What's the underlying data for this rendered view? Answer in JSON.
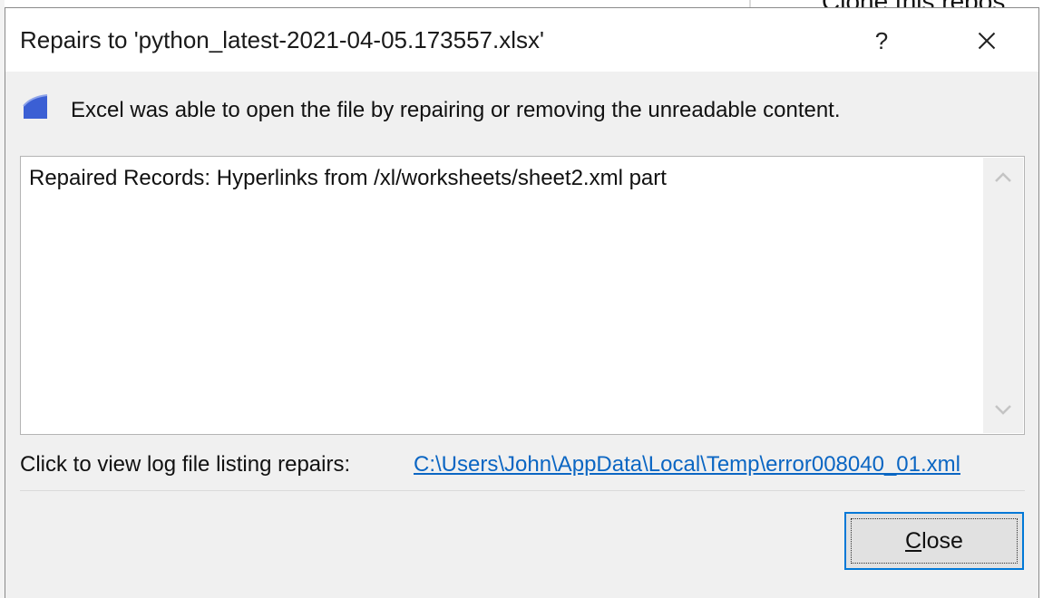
{
  "dialog": {
    "title": "Repairs to 'python_latest-2021-04-05.173557.xlsx'",
    "help_label": "?",
    "message": "Excel was able to open the file by repairing or removing the unreadable content.",
    "details": "Repaired Records: Hyperlinks from /xl/worksheets/sheet2.xml part",
    "log_label": "Click to view log file listing repairs:",
    "log_link": "C:\\Users\\John\\AppData\\Local\\Temp\\error008040_01.xml",
    "close_button": {
      "accesskey": "C",
      "rest": "lose"
    }
  },
  "background": {
    "text": "Clone this repos"
  },
  "colors": {
    "accent": "#0078d7",
    "link": "#0b66c3",
    "dialog_bg": "#f0f0f0"
  }
}
